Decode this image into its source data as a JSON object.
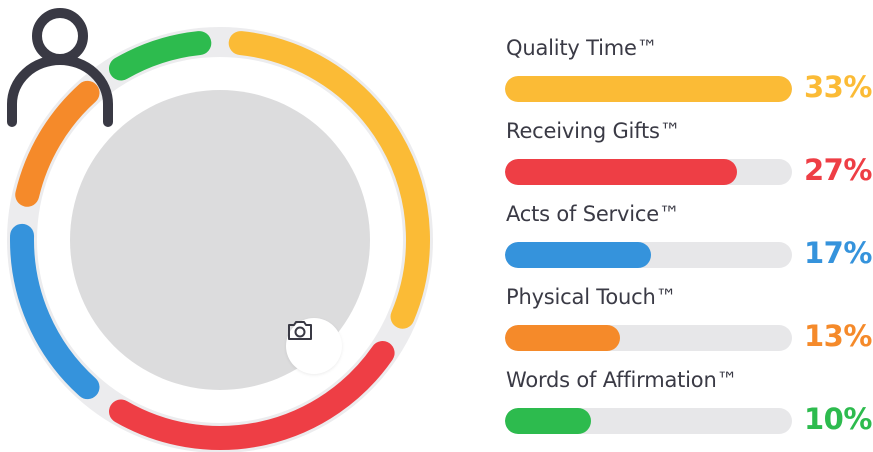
{
  "profile": {
    "avatar_icon": "user-outline-icon",
    "camera_icon": "camera-icon",
    "ring_background": "#ececee",
    "avatar_background": "#dcdcdd",
    "icon_color": "#393944"
  },
  "results": [
    {
      "label": "Quality Time™",
      "percent_text": "33%",
      "fill": 1.0,
      "color": "#fbbb36"
    },
    {
      "label": "Receiving Gifts™",
      "percent_text": "27%",
      "fill": 0.81,
      "color": "#ee3e45"
    },
    {
      "label": "Acts of Service™",
      "percent_text": "17%",
      "fill": 0.51,
      "color": "#3593dc"
    },
    {
      "label": "Physical Touch™",
      "percent_text": "13%",
      "fill": 0.4,
      "color": "#f58a2a"
    },
    {
      "label": "Words of Affirmation™",
      "percent_text": "10%",
      "fill": 0.3,
      "color": "#2dbb4e"
    }
  ]
}
